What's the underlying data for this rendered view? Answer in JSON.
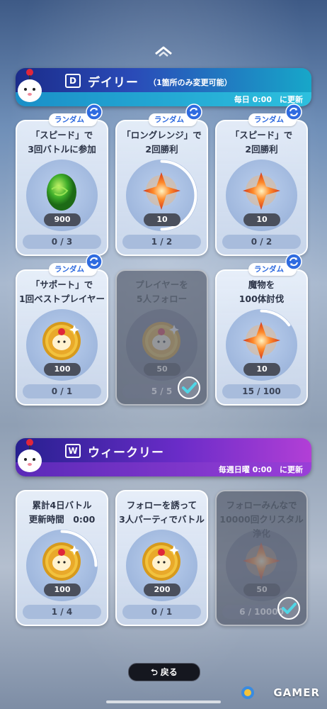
{
  "daily": {
    "title": "デイリー",
    "icon_letter": "D",
    "subtitle": "（1箇所のみ変更可能）",
    "reset_note": "毎日 0:00　に更新"
  },
  "weekly": {
    "title": "ウィークリー",
    "icon_letter": "W",
    "reset_note": "毎週日曜 0:00　に更新"
  },
  "random_label": "ランダム",
  "daily_cards": [
    {
      "text": "「スピード」で\n3回バトルに参加",
      "amount": "900",
      "progress": "0 / 3",
      "reward": "egg",
      "fraction": 0
    },
    {
      "text": "「ロングレンジ」で\n2回勝利",
      "amount": "10",
      "progress": "1 / 2",
      "reward": "crystal",
      "fraction": 0.5
    },
    {
      "text": "「スピード」で\n2回勝利",
      "amount": "10",
      "progress": "0 / 2",
      "reward": "crystal",
      "fraction": 0
    },
    {
      "text": "「サポート」で\n1回ベストプレイヤー",
      "amount": "100",
      "progress": "0 / 1",
      "reward": "coin",
      "fraction": 0
    },
    {
      "text": "プレイヤーを\n5人フォロー",
      "amount": "50",
      "progress": "5 / 5",
      "reward": "coin",
      "fraction": 1,
      "done": true
    },
    {
      "text": "魔物を\n100体討伐",
      "amount": "10",
      "progress": "15 / 100",
      "reward": "crystal",
      "fraction": 0.15
    }
  ],
  "weekly_cards": [
    {
      "text": "累計4日バトル\n更新時間　0:00",
      "amount": "100",
      "progress": "1 / 4",
      "reward": "coin",
      "fraction": 0.25
    },
    {
      "text": "フォローを誘って\n3人パーティでバトル",
      "amount": "200",
      "progress": "0 / 1",
      "reward": "coin",
      "fraction": 0
    },
    {
      "text": "フォローみんなで\n10000回クリスタル浄化",
      "amount": "50",
      "progress": "6 / 10000",
      "reward": "crystal",
      "fraction": 1,
      "done": true
    }
  ],
  "back_button": "戻る",
  "watermark": "GAMER",
  "colors": {
    "accent_blue": "#2f6be0",
    "progress_ring": "#ffffff",
    "check": "#4fd6e6"
  }
}
